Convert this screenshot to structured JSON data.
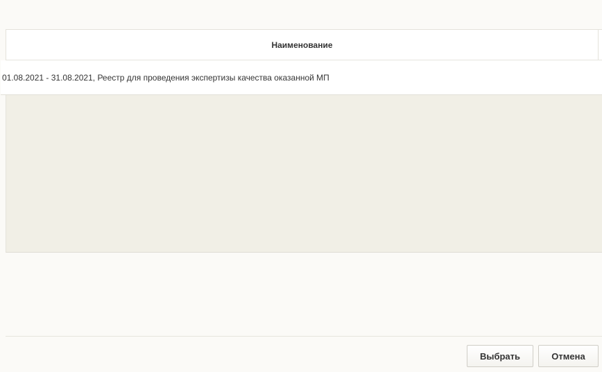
{
  "grid": {
    "columns": [
      {
        "header": "Наименование"
      }
    ],
    "rows": [
      {
        "name": "01.08.2021 - 31.08.2021, Реестр для проведения экспертизы качества оказанной МП"
      }
    ]
  },
  "footer": {
    "select_label": "Выбрать",
    "cancel_label": "Отмена"
  }
}
